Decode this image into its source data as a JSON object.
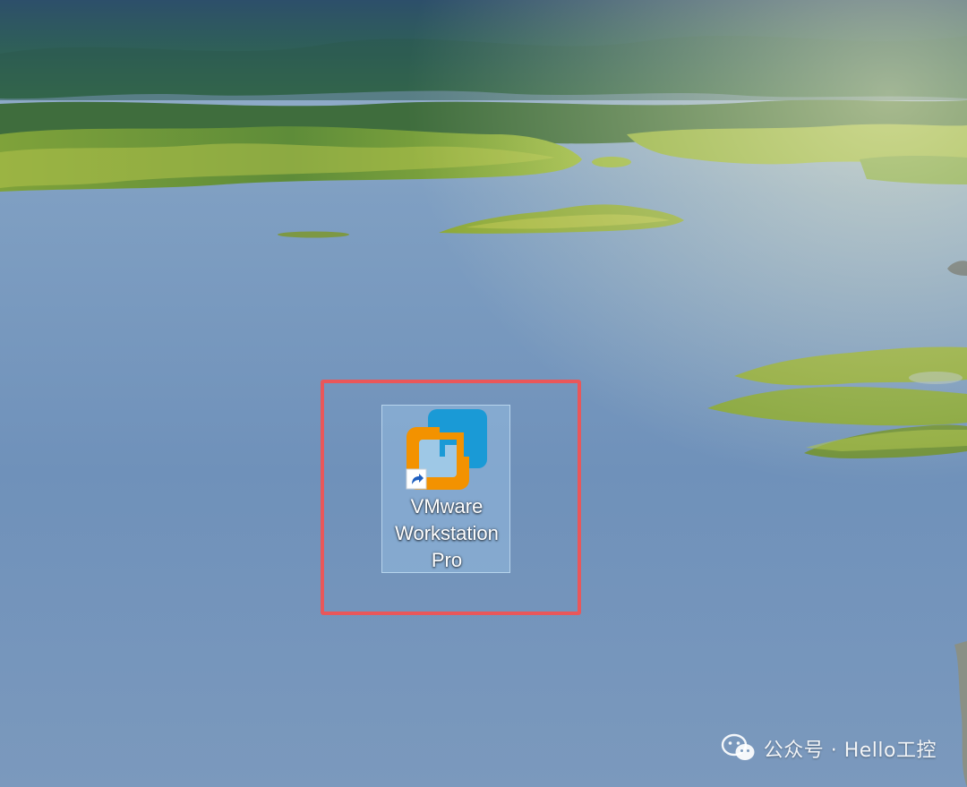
{
  "desktop": {
    "icons": [
      {
        "label_lines": [
          "VMware",
          "Workstation",
          "Pro"
        ],
        "icon": "vmware-workstation-icon",
        "shortcut_overlay": "shortcut-arrow-icon",
        "selected": true
      }
    ]
  },
  "highlight": {
    "color": "#e9575a"
  },
  "watermark": {
    "icon": "wechat-icon",
    "text": "公众号 · Hello工控"
  },
  "colors": {
    "vmware_orange": "#f39200",
    "vmware_blue": "#1a9ad6"
  }
}
